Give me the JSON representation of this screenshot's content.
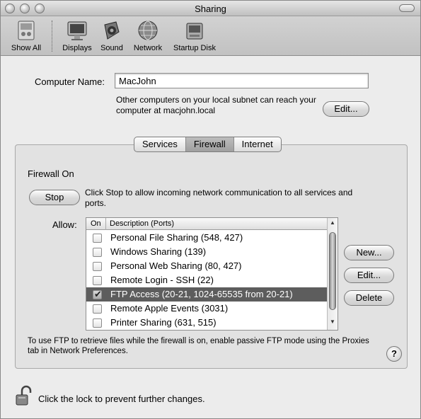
{
  "window": {
    "title": "Sharing"
  },
  "toolbar": {
    "items": [
      {
        "label": "Show All",
        "icon": "grid-icon"
      },
      {
        "label": "Displays",
        "icon": "display-icon"
      },
      {
        "label": "Sound",
        "icon": "speaker-icon"
      },
      {
        "label": "Network",
        "icon": "globe-icon"
      },
      {
        "label": "Startup Disk",
        "icon": "disk-icon"
      }
    ]
  },
  "computer": {
    "name_label": "Computer Name:",
    "name_value": "MacJohn",
    "info_line1": "Other computers on your local subnet can reach your",
    "info_line2": "computer at macjohn.local",
    "edit_label": "Edit..."
  },
  "tabs": [
    {
      "label": "Services",
      "active": false
    },
    {
      "label": "Firewall",
      "active": true
    },
    {
      "label": "Internet",
      "active": false
    }
  ],
  "firewall": {
    "status": "Firewall On",
    "stop_label": "Stop",
    "stop_help_line1": "Click Stop to allow incoming network communication to all services and",
    "stop_help_line2": "ports.",
    "allow_label": "Allow:",
    "col_on": "On",
    "col_desc": "Description (Ports)",
    "rows": [
      {
        "label": "Personal File Sharing (548, 427)",
        "checked": false,
        "selected": false
      },
      {
        "label": "Windows Sharing (139)",
        "checked": false,
        "selected": false
      },
      {
        "label": "Personal Web Sharing (80, 427)",
        "checked": false,
        "selected": false
      },
      {
        "label": "Remote Login - SSH (22)",
        "checked": false,
        "selected": false
      },
      {
        "label": "FTP Access (20-21, 1024-65535 from 20-21)",
        "checked": true,
        "selected": true
      },
      {
        "label": "Remote Apple Events (3031)",
        "checked": false,
        "selected": false
      },
      {
        "label": "Printer Sharing (631, 515)",
        "checked": false,
        "selected": false
      }
    ],
    "new_label": "New...",
    "edit_label": "Edit...",
    "delete_label": "Delete",
    "note_line1": "To use FTP to retrieve files while the firewall is on, enable passive FTP mode using the Proxies",
    "note_line2": "tab in Network Preferences.",
    "help_label": "?"
  },
  "lock": {
    "text": "Click the lock to prevent further changes."
  }
}
